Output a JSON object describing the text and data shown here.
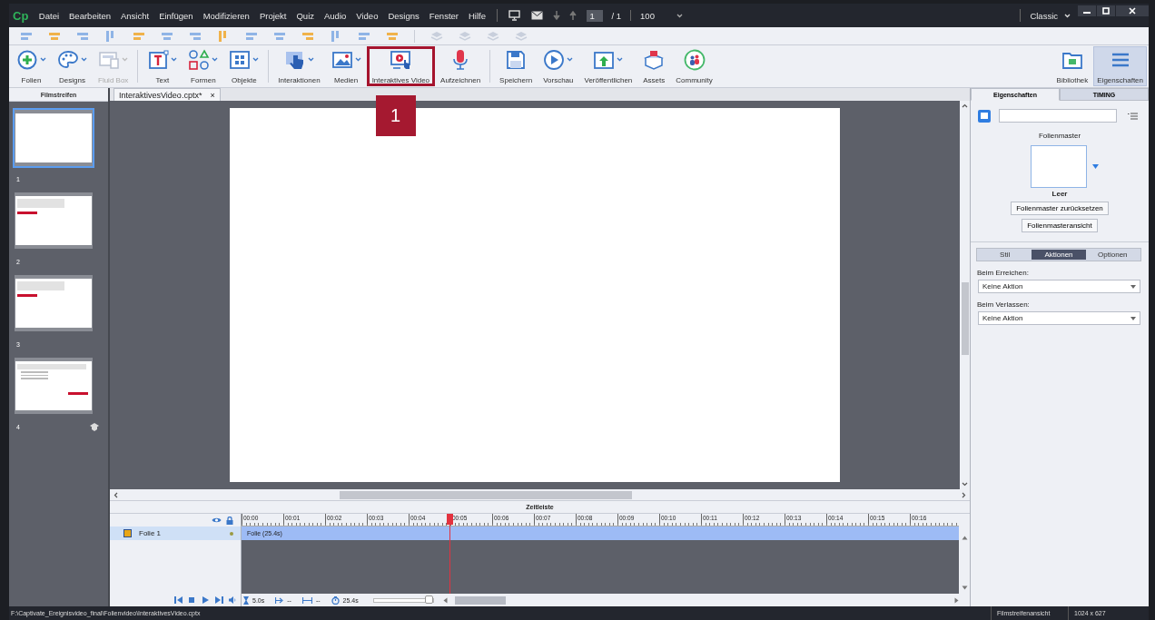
{
  "menu_bar": {
    "logo": "Cp",
    "items": [
      "Datei",
      "Bearbeiten",
      "Ansicht",
      "Einfügen",
      "Modifizieren",
      "Projekt",
      "Quiz",
      "Audio",
      "Video",
      "Designs",
      "Fenster",
      "Hilfe"
    ],
    "current_slide": "1",
    "slide_count": "/ 1",
    "zoom": "100",
    "workspace": "Classic"
  },
  "toolbar": {
    "groups": [
      [
        {
          "label": "Folien",
          "kind": "plus",
          "dropdown": true,
          "disabled": false,
          "selected": false,
          "highlighted": false
        },
        {
          "label": "Designs",
          "kind": "palette",
          "dropdown": true,
          "disabled": false,
          "selected": false,
          "highlighted": false
        },
        {
          "label": "Fluid Box",
          "kind": "fluid",
          "dropdown": true,
          "disabled": true,
          "selected": false,
          "highlighted": false
        }
      ],
      [
        {
          "label": "Text",
          "kind": "text",
          "dropdown": true,
          "disabled": false,
          "selected": false,
          "highlighted": false
        },
        {
          "label": "Formen",
          "kind": "shapes",
          "dropdown": true,
          "disabled": false,
          "selected": false,
          "highlighted": false
        },
        {
          "label": "Objekte",
          "kind": "objects",
          "dropdown": true,
          "disabled": false,
          "selected": false,
          "highlighted": false
        }
      ],
      [
        {
          "label": "Interaktionen",
          "kind": "hand",
          "dropdown": true,
          "disabled": false,
          "selected": false,
          "highlighted": false
        },
        {
          "label": "Medien",
          "kind": "image",
          "dropdown": true,
          "disabled": false,
          "selected": false,
          "highlighted": false
        },
        {
          "label": "Interaktives Video",
          "kind": "video",
          "dropdown": false,
          "disabled": false,
          "selected": false,
          "highlighted": true,
          "callout": "1"
        },
        {
          "label": "Aufzeichnen",
          "kind": "mic",
          "dropdown": false,
          "disabled": false,
          "selected": false,
          "highlighted": false
        }
      ],
      [
        {
          "label": "Speichern",
          "kind": "save",
          "dropdown": false,
          "disabled": false,
          "selected": false,
          "highlighted": false
        },
        {
          "label": "Vorschau",
          "kind": "play",
          "dropdown": true,
          "disabled": false,
          "selected": false,
          "highlighted": false
        },
        {
          "label": "Veröffentlichen",
          "kind": "publish",
          "dropdown": true,
          "disabled": false,
          "selected": false,
          "highlighted": false
        },
        {
          "label": "Assets",
          "kind": "assets",
          "dropdown": false,
          "disabled": false,
          "selected": false,
          "highlighted": false
        },
        {
          "label": "Community",
          "kind": "community",
          "dropdown": false,
          "disabled": false,
          "selected": false,
          "highlighted": false
        }
      ]
    ],
    "right": [
      {
        "label": "Bibliothek",
        "kind": "folder",
        "dropdown": false,
        "disabled": false,
        "selected": false,
        "highlighted": false
      },
      {
        "label": "Eigenschaften",
        "kind": "menu",
        "dropdown": false,
        "disabled": false,
        "selected": true,
        "highlighted": false
      }
    ]
  },
  "filmstrip": {
    "title": "Filmstreifen",
    "slides": [
      {
        "number": "1",
        "kind": "blank",
        "selected": true,
        "quiz": false
      },
      {
        "number": "2",
        "kind": "text-button",
        "selected": false,
        "quiz": false
      },
      {
        "number": "3",
        "kind": "text-button",
        "selected": false,
        "quiz": false
      },
      {
        "number": "4",
        "kind": "list-button",
        "selected": false,
        "quiz": true
      }
    ]
  },
  "document_tab": {
    "title": "InteraktivesVideo.cptx*",
    "close": "×"
  },
  "timeline": {
    "title": "Zeitleiste",
    "ticks": [
      "00:00",
      "00:01",
      "00:02",
      "00:03",
      "00:04",
      "00:05",
      "00:06",
      "00:07",
      "00:08",
      "00:09",
      "00:10",
      "00:11",
      "00:12",
      "00:13",
      "00:14",
      "00:15",
      "00:16"
    ],
    "rows": [
      {
        "name": "Folie 1",
        "bar": "Folie (25.4s)",
        "selected": true
      }
    ],
    "playhead": {
      "level": 0.29
    },
    "slide_duration": "5.0s",
    "start": "--",
    "length": "--",
    "total": "25.4s",
    "zoom": {
      "level": 0.95
    }
  },
  "properties": {
    "tabs": [
      {
        "label": "Eigenschaften",
        "selected": true
      },
      {
        "label": "TIMING",
        "selected": false
      }
    ],
    "master_label": "Folienmaster",
    "master_name": "Leer",
    "buttons": [
      "Folienmaster zurücksetzen",
      "Folienmasteransicht"
    ],
    "subtabs": [
      {
        "label": "Stil",
        "selected": false
      },
      {
        "label": "Aktionen",
        "selected": true
      },
      {
        "label": "Optionen",
        "selected": false
      }
    ],
    "fields": [
      {
        "label": "Beim Erreichen:",
        "value": "Keine Aktion"
      },
      {
        "label": "Beim Verlassen:",
        "value": "Keine Aktion"
      }
    ]
  },
  "status_bar": {
    "path": "F:\\Captivate_Ereignisvideo_final\\Folienvideo\\InteraktivesVideo.cptx",
    "view": "Filmstreifenansicht",
    "size": "1024 x 627"
  }
}
